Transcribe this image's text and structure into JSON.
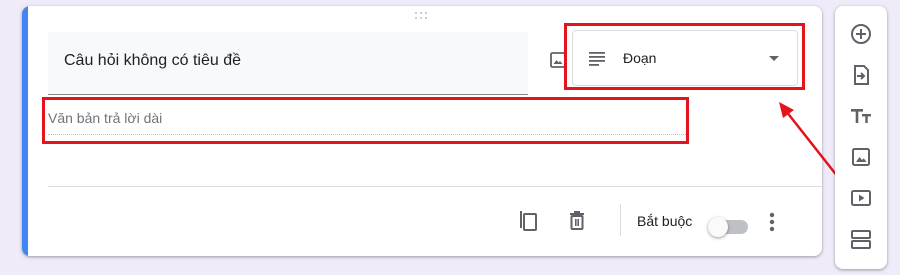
{
  "question": {
    "title": "Câu hỏi không có tiêu đề",
    "type_label": "Đoạn",
    "answer_placeholder": "Văn bản trả lời dài"
  },
  "footer": {
    "required_label": "Bắt buộc",
    "required_on": false
  },
  "icons": {
    "drag": "drag-handle-icon",
    "image": "image-icon",
    "type": "paragraph-lines-icon",
    "duplicate": "copy-icon",
    "delete": "trash-icon",
    "more": "more-vert-icon",
    "toolbar": [
      "add-circle-icon",
      "import-icon",
      "title-text-icon",
      "image-icon",
      "video-icon",
      "section-icon"
    ]
  },
  "colors": {
    "accent": "#4285f4",
    "highlight": "#e3141b",
    "background": "#f0ebf8"
  }
}
